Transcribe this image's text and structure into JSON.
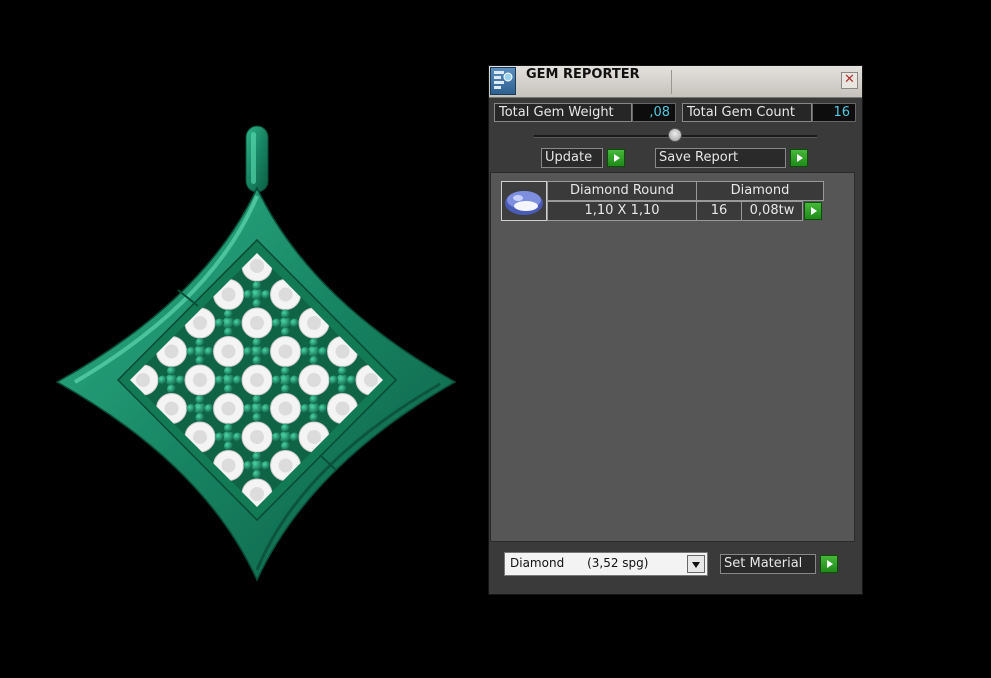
{
  "panel": {
    "title": "GEM REPORTER",
    "close_glyph": "✕",
    "total_weight_label": "Total Gem Weight",
    "total_weight_value": ",08",
    "total_count_label": "Total Gem Count",
    "total_count_value": "16",
    "update_label": "Update",
    "save_report_label": "Save Report",
    "gem_row": {
      "icon": "round-gem-icon",
      "name": "Diamond Round",
      "material": "Diamond",
      "size": "1,10 X 1,10",
      "count": "16",
      "weight": "0,08tw"
    },
    "material_select": {
      "value": "Diamond      (3,52 spg)"
    },
    "set_material_label": "Set Material"
  },
  "colors": {
    "pendant_green": "#1a8a65",
    "value_text": "#56c6e0",
    "go_button": "#2fa325",
    "panel_bg": "#3a3a3a",
    "list_bg": "#565656"
  }
}
